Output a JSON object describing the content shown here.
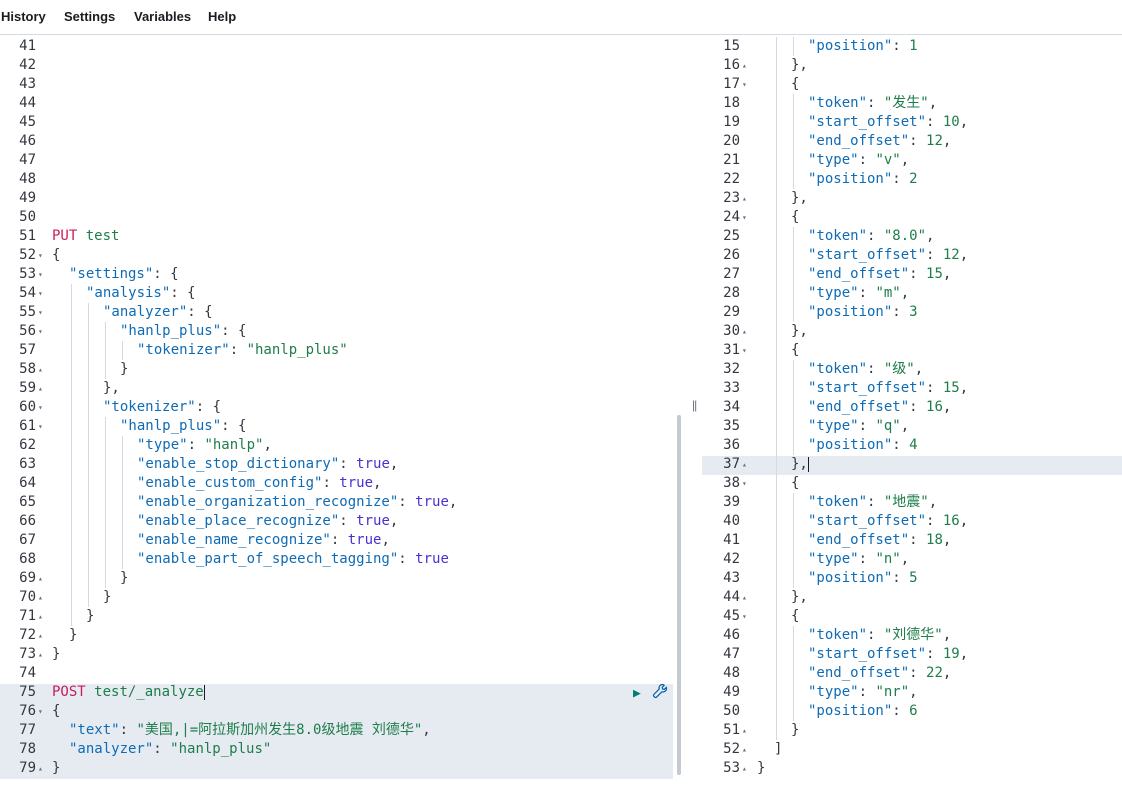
{
  "menu": {
    "history": "History",
    "settings": "Settings",
    "variables": "Variables",
    "help": "Help"
  },
  "divider_grip": "||",
  "left_editor": {
    "lines": [
      {
        "n": "41",
        "fold": "",
        "indent": 0,
        "tokens": []
      },
      {
        "n": "42",
        "fold": "",
        "indent": 0,
        "tokens": []
      },
      {
        "n": "43",
        "fold": "",
        "indent": 0,
        "tokens": []
      },
      {
        "n": "44",
        "fold": "",
        "indent": 0,
        "tokens": []
      },
      {
        "n": "45",
        "fold": "",
        "indent": 0,
        "tokens": []
      },
      {
        "n": "46",
        "fold": "",
        "indent": 0,
        "tokens": []
      },
      {
        "n": "47",
        "fold": "",
        "indent": 0,
        "tokens": []
      },
      {
        "n": "48",
        "fold": "",
        "indent": 0,
        "tokens": []
      },
      {
        "n": "49",
        "fold": "",
        "indent": 0,
        "tokens": []
      },
      {
        "n": "50",
        "fold": "",
        "indent": 0,
        "tokens": []
      },
      {
        "n": "51",
        "fold": "",
        "indent": 0,
        "tokens": [
          [
            "method",
            "PUT"
          ],
          [
            "k",
            " "
          ],
          [
            "url",
            "test"
          ]
        ]
      },
      {
        "n": "52",
        "fold": "▾",
        "indent": 0,
        "tokens": [
          [
            "k",
            "{"
          ]
        ]
      },
      {
        "n": "53",
        "fold": "▾",
        "indent": 1,
        "tokens": [
          [
            "key",
            "\"settings\""
          ],
          [
            "k",
            ": {"
          ]
        ]
      },
      {
        "n": "54",
        "fold": "▾",
        "indent": 2,
        "tokens": [
          [
            "key",
            "\"analysis\""
          ],
          [
            "k",
            ": {"
          ]
        ]
      },
      {
        "n": "55",
        "fold": "▾",
        "indent": 3,
        "tokens": [
          [
            "key",
            "\"analyzer\""
          ],
          [
            "k",
            ": {"
          ]
        ]
      },
      {
        "n": "56",
        "fold": "▾",
        "indent": 4,
        "tokens": [
          [
            "key",
            "\"hanlp_plus\""
          ],
          [
            "k",
            ": {"
          ]
        ]
      },
      {
        "n": "57",
        "fold": "",
        "indent": 5,
        "tokens": [
          [
            "key",
            "\"tokenizer\""
          ],
          [
            "k",
            ": "
          ],
          [
            "str",
            "\"hanlp_plus\""
          ]
        ]
      },
      {
        "n": "58",
        "fold": "▴",
        "indent": 4,
        "tokens": [
          [
            "k",
            "}"
          ]
        ]
      },
      {
        "n": "59",
        "fold": "▴",
        "indent": 3,
        "tokens": [
          [
            "k",
            "},"
          ]
        ]
      },
      {
        "n": "60",
        "fold": "▾",
        "indent": 3,
        "tokens": [
          [
            "key",
            "\"tokenizer\""
          ],
          [
            "k",
            ": {"
          ]
        ]
      },
      {
        "n": "61",
        "fold": "▾",
        "indent": 4,
        "tokens": [
          [
            "key",
            "\"hanlp_plus\""
          ],
          [
            "k",
            ": {"
          ]
        ]
      },
      {
        "n": "62",
        "fold": "",
        "indent": 5,
        "tokens": [
          [
            "key",
            "\"type\""
          ],
          [
            "k",
            ": "
          ],
          [
            "str",
            "\"hanlp\""
          ],
          [
            "k",
            ","
          ]
        ]
      },
      {
        "n": "63",
        "fold": "",
        "indent": 5,
        "tokens": [
          [
            "key",
            "\"enable_stop_dictionary\""
          ],
          [
            "k",
            ": "
          ],
          [
            "bool",
            "true"
          ],
          [
            "k",
            ","
          ]
        ]
      },
      {
        "n": "64",
        "fold": "",
        "indent": 5,
        "tokens": [
          [
            "key",
            "\"enable_custom_config\""
          ],
          [
            "k",
            ": "
          ],
          [
            "bool",
            "true"
          ],
          [
            "k",
            ","
          ]
        ]
      },
      {
        "n": "65",
        "fold": "",
        "indent": 5,
        "tokens": [
          [
            "key",
            "\"enable_organization_recognize\""
          ],
          [
            "k",
            ": "
          ],
          [
            "bool",
            "true"
          ],
          [
            "k",
            ","
          ]
        ]
      },
      {
        "n": "66",
        "fold": "",
        "indent": 5,
        "tokens": [
          [
            "key",
            "\"enable_place_recognize\""
          ],
          [
            "k",
            ": "
          ],
          [
            "bool",
            "true"
          ],
          [
            "k",
            ","
          ]
        ]
      },
      {
        "n": "67",
        "fold": "",
        "indent": 5,
        "tokens": [
          [
            "key",
            "\"enable_name_recognize\""
          ],
          [
            "k",
            ": "
          ],
          [
            "bool",
            "true"
          ],
          [
            "k",
            ","
          ]
        ]
      },
      {
        "n": "68",
        "fold": "",
        "indent": 5,
        "tokens": [
          [
            "key",
            "\"enable_part_of_speech_tagging\""
          ],
          [
            "k",
            ": "
          ],
          [
            "bool",
            "true"
          ]
        ]
      },
      {
        "n": "69",
        "fold": "▴",
        "indent": 4,
        "tokens": [
          [
            "k",
            "}"
          ]
        ]
      },
      {
        "n": "70",
        "fold": "▴",
        "indent": 3,
        "tokens": [
          [
            "k",
            "}"
          ]
        ]
      },
      {
        "n": "71",
        "fold": "▴",
        "indent": 2,
        "tokens": [
          [
            "k",
            "}"
          ]
        ]
      },
      {
        "n": "72",
        "fold": "▴",
        "indent": 1,
        "tokens": [
          [
            "k",
            "}"
          ]
        ]
      },
      {
        "n": "73",
        "fold": "▴",
        "indent": 0,
        "tokens": [
          [
            "k",
            "}"
          ]
        ]
      },
      {
        "n": "74",
        "fold": "",
        "indent": 0,
        "tokens": []
      },
      {
        "n": "75",
        "fold": "",
        "indent": 0,
        "tokens": [
          [
            "method",
            "POST"
          ],
          [
            "k",
            " "
          ],
          [
            "url",
            "test/_analyze"
          ]
        ],
        "cursor": true
      },
      {
        "n": "76",
        "fold": "▾",
        "indent": 0,
        "tokens": [
          [
            "k",
            "{"
          ]
        ]
      },
      {
        "n": "77",
        "fold": "",
        "indent": 1,
        "tokens": [
          [
            "key",
            "\"text\""
          ],
          [
            "k",
            ": "
          ],
          [
            "str",
            "\"美国,|=阿拉斯加州发生8.0级地震 刘德华\""
          ],
          [
            "k",
            ","
          ]
        ]
      },
      {
        "n": "78",
        "fold": "",
        "indent": 1,
        "tokens": [
          [
            "key",
            "\"analyzer\""
          ],
          [
            "k",
            ": "
          ],
          [
            "str",
            "\"hanlp_plus\""
          ]
        ]
      },
      {
        "n": "79",
        "fold": "▴",
        "indent": 0,
        "tokens": [
          [
            "k",
            "}"
          ]
        ]
      }
    ]
  },
  "right_editor": {
    "lines": [
      {
        "n": "15",
        "fold": "",
        "indent": 3,
        "tokens": [
          [
            "key",
            "\"position\""
          ],
          [
            "k",
            ": "
          ],
          [
            "num",
            "1"
          ]
        ]
      },
      {
        "n": "16",
        "fold": "▴",
        "indent": 2,
        "tokens": [
          [
            "k",
            "},"
          ]
        ]
      },
      {
        "n": "17",
        "fold": "▾",
        "indent": 2,
        "tokens": [
          [
            "k",
            "{"
          ]
        ]
      },
      {
        "n": "18",
        "fold": "",
        "indent": 3,
        "tokens": [
          [
            "key",
            "\"token\""
          ],
          [
            "k",
            ": "
          ],
          [
            "str",
            "\"发生\""
          ],
          [
            "k",
            ","
          ]
        ]
      },
      {
        "n": "19",
        "fold": "",
        "indent": 3,
        "tokens": [
          [
            "key",
            "\"start_offset\""
          ],
          [
            "k",
            ": "
          ],
          [
            "num",
            "10"
          ],
          [
            "k",
            ","
          ]
        ]
      },
      {
        "n": "20",
        "fold": "",
        "indent": 3,
        "tokens": [
          [
            "key",
            "\"end_offset\""
          ],
          [
            "k",
            ": "
          ],
          [
            "num",
            "12"
          ],
          [
            "k",
            ","
          ]
        ]
      },
      {
        "n": "21",
        "fold": "",
        "indent": 3,
        "tokens": [
          [
            "key",
            "\"type\""
          ],
          [
            "k",
            ": "
          ],
          [
            "str",
            "\"v\""
          ],
          [
            "k",
            ","
          ]
        ]
      },
      {
        "n": "22",
        "fold": "",
        "indent": 3,
        "tokens": [
          [
            "key",
            "\"position\""
          ],
          [
            "k",
            ": "
          ],
          [
            "num",
            "2"
          ]
        ]
      },
      {
        "n": "23",
        "fold": "▴",
        "indent": 2,
        "tokens": [
          [
            "k",
            "},"
          ]
        ]
      },
      {
        "n": "24",
        "fold": "▾",
        "indent": 2,
        "tokens": [
          [
            "k",
            "{"
          ]
        ]
      },
      {
        "n": "25",
        "fold": "",
        "indent": 3,
        "tokens": [
          [
            "key",
            "\"token\""
          ],
          [
            "k",
            ": "
          ],
          [
            "str",
            "\"8.0\""
          ],
          [
            "k",
            ","
          ]
        ]
      },
      {
        "n": "26",
        "fold": "",
        "indent": 3,
        "tokens": [
          [
            "key",
            "\"start_offset\""
          ],
          [
            "k",
            ": "
          ],
          [
            "num",
            "12"
          ],
          [
            "k",
            ","
          ]
        ]
      },
      {
        "n": "27",
        "fold": "",
        "indent": 3,
        "tokens": [
          [
            "key",
            "\"end_offset\""
          ],
          [
            "k",
            ": "
          ],
          [
            "num",
            "15"
          ],
          [
            "k",
            ","
          ]
        ]
      },
      {
        "n": "28",
        "fold": "",
        "indent": 3,
        "tokens": [
          [
            "key",
            "\"type\""
          ],
          [
            "k",
            ": "
          ],
          [
            "str",
            "\"m\""
          ],
          [
            "k",
            ","
          ]
        ]
      },
      {
        "n": "29",
        "fold": "",
        "indent": 3,
        "tokens": [
          [
            "key",
            "\"position\""
          ],
          [
            "k",
            ": "
          ],
          [
            "num",
            "3"
          ]
        ]
      },
      {
        "n": "30",
        "fold": "▴",
        "indent": 2,
        "tokens": [
          [
            "k",
            "},"
          ]
        ]
      },
      {
        "n": "31",
        "fold": "▾",
        "indent": 2,
        "tokens": [
          [
            "k",
            "{"
          ]
        ]
      },
      {
        "n": "32",
        "fold": "",
        "indent": 3,
        "tokens": [
          [
            "key",
            "\"token\""
          ],
          [
            "k",
            ": "
          ],
          [
            "str",
            "\"级\""
          ],
          [
            "k",
            ","
          ]
        ]
      },
      {
        "n": "33",
        "fold": "",
        "indent": 3,
        "tokens": [
          [
            "key",
            "\"start_offset\""
          ],
          [
            "k",
            ": "
          ],
          [
            "num",
            "15"
          ],
          [
            "k",
            ","
          ]
        ]
      },
      {
        "n": "34",
        "fold": "",
        "indent": 3,
        "tokens": [
          [
            "key",
            "\"end_offset\""
          ],
          [
            "k",
            ": "
          ],
          [
            "num",
            "16"
          ],
          [
            "k",
            ","
          ]
        ]
      },
      {
        "n": "35",
        "fold": "",
        "indent": 3,
        "tokens": [
          [
            "key",
            "\"type\""
          ],
          [
            "k",
            ": "
          ],
          [
            "str",
            "\"q\""
          ],
          [
            "k",
            ","
          ]
        ]
      },
      {
        "n": "36",
        "fold": "",
        "indent": 3,
        "tokens": [
          [
            "key",
            "\"position\""
          ],
          [
            "k",
            ": "
          ],
          [
            "num",
            "4"
          ]
        ]
      },
      {
        "n": "37",
        "fold": "▴",
        "indent": 2,
        "tokens": [
          [
            "k",
            "},"
          ]
        ],
        "cursor": true
      },
      {
        "n": "38",
        "fold": "▾",
        "indent": 2,
        "tokens": [
          [
            "k",
            "{"
          ]
        ]
      },
      {
        "n": "39",
        "fold": "",
        "indent": 3,
        "tokens": [
          [
            "key",
            "\"token\""
          ],
          [
            "k",
            ": "
          ],
          [
            "str",
            "\"地震\""
          ],
          [
            "k",
            ","
          ]
        ]
      },
      {
        "n": "40",
        "fold": "",
        "indent": 3,
        "tokens": [
          [
            "key",
            "\"start_offset\""
          ],
          [
            "k",
            ": "
          ],
          [
            "num",
            "16"
          ],
          [
            "k",
            ","
          ]
        ]
      },
      {
        "n": "41",
        "fold": "",
        "indent": 3,
        "tokens": [
          [
            "key",
            "\"end_offset\""
          ],
          [
            "k",
            ": "
          ],
          [
            "num",
            "18"
          ],
          [
            "k",
            ","
          ]
        ]
      },
      {
        "n": "42",
        "fold": "",
        "indent": 3,
        "tokens": [
          [
            "key",
            "\"type\""
          ],
          [
            "k",
            ": "
          ],
          [
            "str",
            "\"n\""
          ],
          [
            "k",
            ","
          ]
        ]
      },
      {
        "n": "43",
        "fold": "",
        "indent": 3,
        "tokens": [
          [
            "key",
            "\"position\""
          ],
          [
            "k",
            ": "
          ],
          [
            "num",
            "5"
          ]
        ]
      },
      {
        "n": "44",
        "fold": "▴",
        "indent": 2,
        "tokens": [
          [
            "k",
            "},"
          ]
        ]
      },
      {
        "n": "45",
        "fold": "▾",
        "indent": 2,
        "tokens": [
          [
            "k",
            "{"
          ]
        ]
      },
      {
        "n": "46",
        "fold": "",
        "indent": 3,
        "tokens": [
          [
            "key",
            "\"token\""
          ],
          [
            "k",
            ": "
          ],
          [
            "str",
            "\"刘德华\""
          ],
          [
            "k",
            ","
          ]
        ]
      },
      {
        "n": "47",
        "fold": "",
        "indent": 3,
        "tokens": [
          [
            "key",
            "\"start_offset\""
          ],
          [
            "k",
            ": "
          ],
          [
            "num",
            "19"
          ],
          [
            "k",
            ","
          ]
        ]
      },
      {
        "n": "48",
        "fold": "",
        "indent": 3,
        "tokens": [
          [
            "key",
            "\"end_offset\""
          ],
          [
            "k",
            ": "
          ],
          [
            "num",
            "22"
          ],
          [
            "k",
            ","
          ]
        ]
      },
      {
        "n": "49",
        "fold": "",
        "indent": 3,
        "tokens": [
          [
            "key",
            "\"type\""
          ],
          [
            "k",
            ": "
          ],
          [
            "str",
            "\"nr\""
          ],
          [
            "k",
            ","
          ]
        ]
      },
      {
        "n": "50",
        "fold": "",
        "indent": 3,
        "tokens": [
          [
            "key",
            "\"position\""
          ],
          [
            "k",
            ": "
          ],
          [
            "num",
            "6"
          ]
        ]
      },
      {
        "n": "51",
        "fold": "▴",
        "indent": 2,
        "tokens": [
          [
            "k",
            "}"
          ]
        ]
      },
      {
        "n": "52",
        "fold": "▴",
        "indent": 1,
        "tokens": [
          [
            "k",
            "]"
          ]
        ]
      },
      {
        "n": "53",
        "fold": "▴",
        "indent": 0,
        "tokens": [
          [
            "k",
            "}"
          ]
        ]
      }
    ]
  },
  "actions": {
    "run_icon": "play-icon",
    "settings_icon": "wrench-icon"
  },
  "colors": {
    "method": "#c61e5b",
    "key": "#0f6bb4",
    "string": "#1e7d4a",
    "boolean": "#4c2fd1",
    "active_line": "#e6ebf2"
  }
}
